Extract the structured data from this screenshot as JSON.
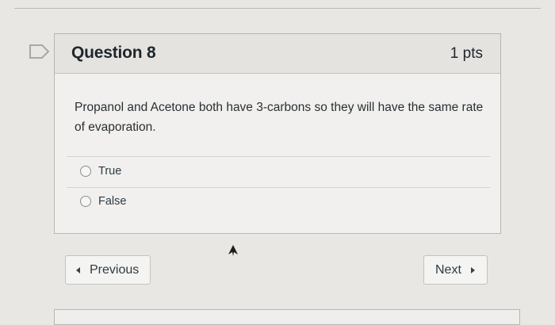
{
  "question": {
    "title": "Question 8",
    "points": "1 pts",
    "text": "Propanol and Acetone both have 3-carbons so they will have the same rate of evaporation.",
    "answers": [
      {
        "label": "True",
        "selected": false
      },
      {
        "label": "False",
        "selected": false
      }
    ]
  },
  "navigation": {
    "previous_label": "Previous",
    "next_label": "Next"
  },
  "icons": {
    "flag": "flag-question-icon",
    "cursor": "mouse-cursor-icon"
  }
}
